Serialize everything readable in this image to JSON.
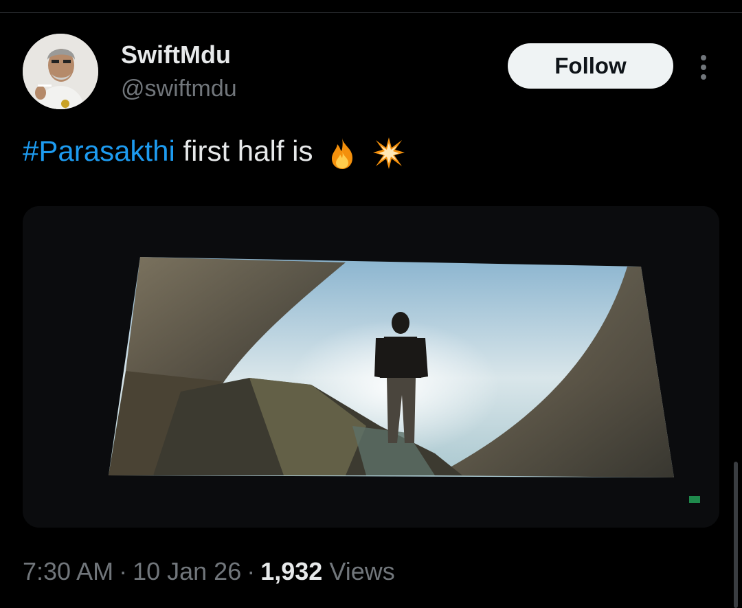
{
  "user": {
    "display_name": "SwiftMdu",
    "handle": "@swiftmdu"
  },
  "follow_label": "Follow",
  "tweet": {
    "hashtag": "#Parasakthi",
    "text": " first half is",
    "emojis": [
      "fire-emoji",
      "collision-emoji"
    ]
  },
  "meta": {
    "time": "7:30 AM",
    "date": "10 Jan 26",
    "views_count": "1,932",
    "views_label": "Views",
    "separator": "·"
  },
  "colors": {
    "background": "#000000",
    "text_primary": "#e7e9ea",
    "text_secondary": "#71767b",
    "link": "#1d9bf0",
    "follow_button_bg": "#eff3f4"
  }
}
